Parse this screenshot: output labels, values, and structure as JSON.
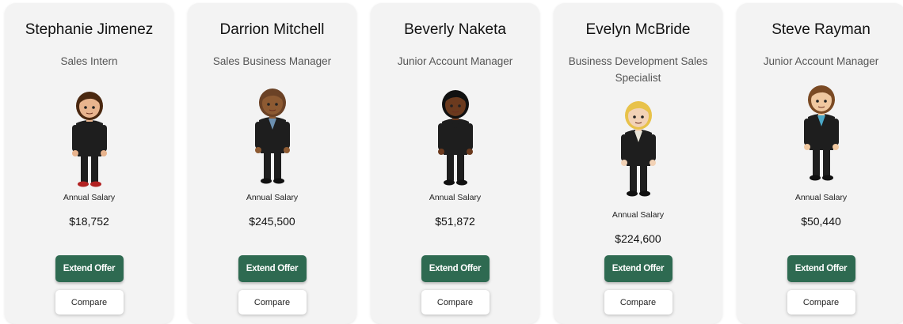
{
  "candidates": [
    {
      "name": "Stephanie Jimenez",
      "title": "Sales Intern",
      "salary_label": "Annual Salary",
      "salary": "$18,752",
      "offer_label": "Extend Offer",
      "compare_label": "Compare",
      "avatar": {
        "hair": "#4a2810",
        "skin": "#e8b48e",
        "suit": "#1e1e1e",
        "shirt": "#1e1e1e",
        "shoes": "#b22222"
      }
    },
    {
      "name": "Darrion Mitchell",
      "title": "Sales Business Manager",
      "salary_label": "Annual Salary",
      "salary": "$245,500",
      "offer_label": "Extend Offer",
      "compare_label": "Compare",
      "avatar": {
        "hair": "#6b4226",
        "skin": "#8d5a32",
        "suit": "#1e1e1e",
        "shirt": "#6b8fb0",
        "shoes": "#111111"
      }
    },
    {
      "name": "Beverly Naketa",
      "title": "Junior Account Manager",
      "salary_label": "Annual Salary",
      "salary": "$51,872",
      "offer_label": "Extend Offer",
      "compare_label": "Compare",
      "avatar": {
        "hair": "#111111",
        "skin": "#6b3a1e",
        "suit": "#1e1e1e",
        "shirt": "#1e1e1e",
        "shoes": "#111111"
      }
    },
    {
      "name": "Evelyn McBride",
      "title": "Business Development Sales Specialist",
      "salary_label": "Annual Salary",
      "salary": "$224,600",
      "offer_label": "Extend Offer",
      "compare_label": "Compare",
      "avatar": {
        "hair": "#e8c24a",
        "skin": "#f2d2b6",
        "suit": "#1e1e1e",
        "shirt": "#e8e4d8",
        "shoes": "#111111"
      }
    },
    {
      "name": "Steve Rayman",
      "title": "Junior Account Manager",
      "salary_label": "Annual Salary",
      "salary": "$50,440",
      "offer_label": "Extend Offer",
      "compare_label": "Compare",
      "avatar": {
        "hair": "#7a4a24",
        "skin": "#f0c8a0",
        "suit": "#1e1e1e",
        "shirt": "#4aa8c8",
        "shoes": "#111111"
      }
    }
  ],
  "colors": {
    "card_bg": "#f3f3f3",
    "offer_button": "#2e6a51",
    "offer_text": "#ffffff",
    "compare_button": "#ffffff"
  }
}
